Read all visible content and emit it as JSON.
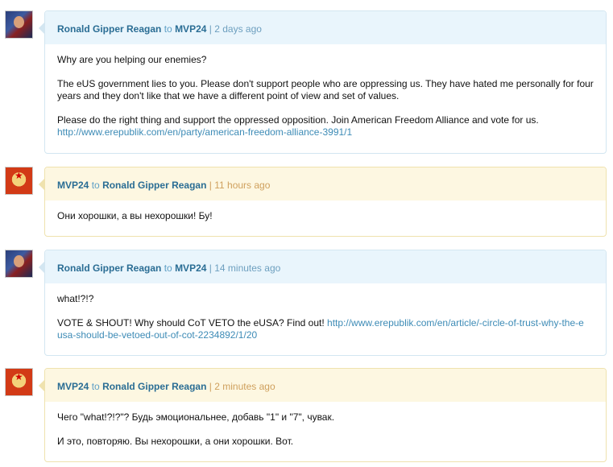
{
  "messages": [
    {
      "from": "Ronald Gipper Reagan",
      "to_word": "to",
      "to": "MVP24",
      "sep": "|",
      "time": "2 days ago",
      "theme": "blue",
      "paragraphs": [
        "Why are you helping our enemies?",
        "The eUS government lies to you. Please don't support people who are oppressing us. They have hated me personally for four years and they don't like that we have a different point of view and set of values.",
        "Please do the right thing and support the oppressed opposition. Join American Freedom Alliance and vote for us."
      ],
      "link": "http://www.erepublik.com/en/party/american-freedom-alliance-3991/1"
    },
    {
      "from": "MVP24",
      "to_word": "to",
      "to": "Ronald Gipper Reagan",
      "sep": "|",
      "time": "11 hours ago",
      "theme": "yellow",
      "paragraphs": [
        "Они хорошки, а вы нехорошки! Бу!"
      ]
    },
    {
      "from": "Ronald Gipper Reagan",
      "to_word": "to",
      "to": "MVP24",
      "sep": "|",
      "time": "14 minutes ago",
      "theme": "blue",
      "paragraphs": [
        "what!?!?",
        "VOTE & SHOUT! Why should CoT VETO the eUSA? Find out!"
      ],
      "link": "http://www.erepublik.com/en/article/-circle-of-trust-why-the-eusa-should-be-vetoed-out-of-cot-2234892/1/20"
    },
    {
      "from": "MVP24",
      "to_word": "to",
      "to": "Ronald Gipper Reagan",
      "sep": "|",
      "time": "2 minutes ago",
      "theme": "yellow",
      "paragraphs": [
        "Чего \"what!?!?\"? Будь эмоциональнее, добавь \"1\" и \"7\", чувак.",
        "И это, повторяю. Вы нехорошки, а они хорошки. Вот."
      ]
    }
  ]
}
